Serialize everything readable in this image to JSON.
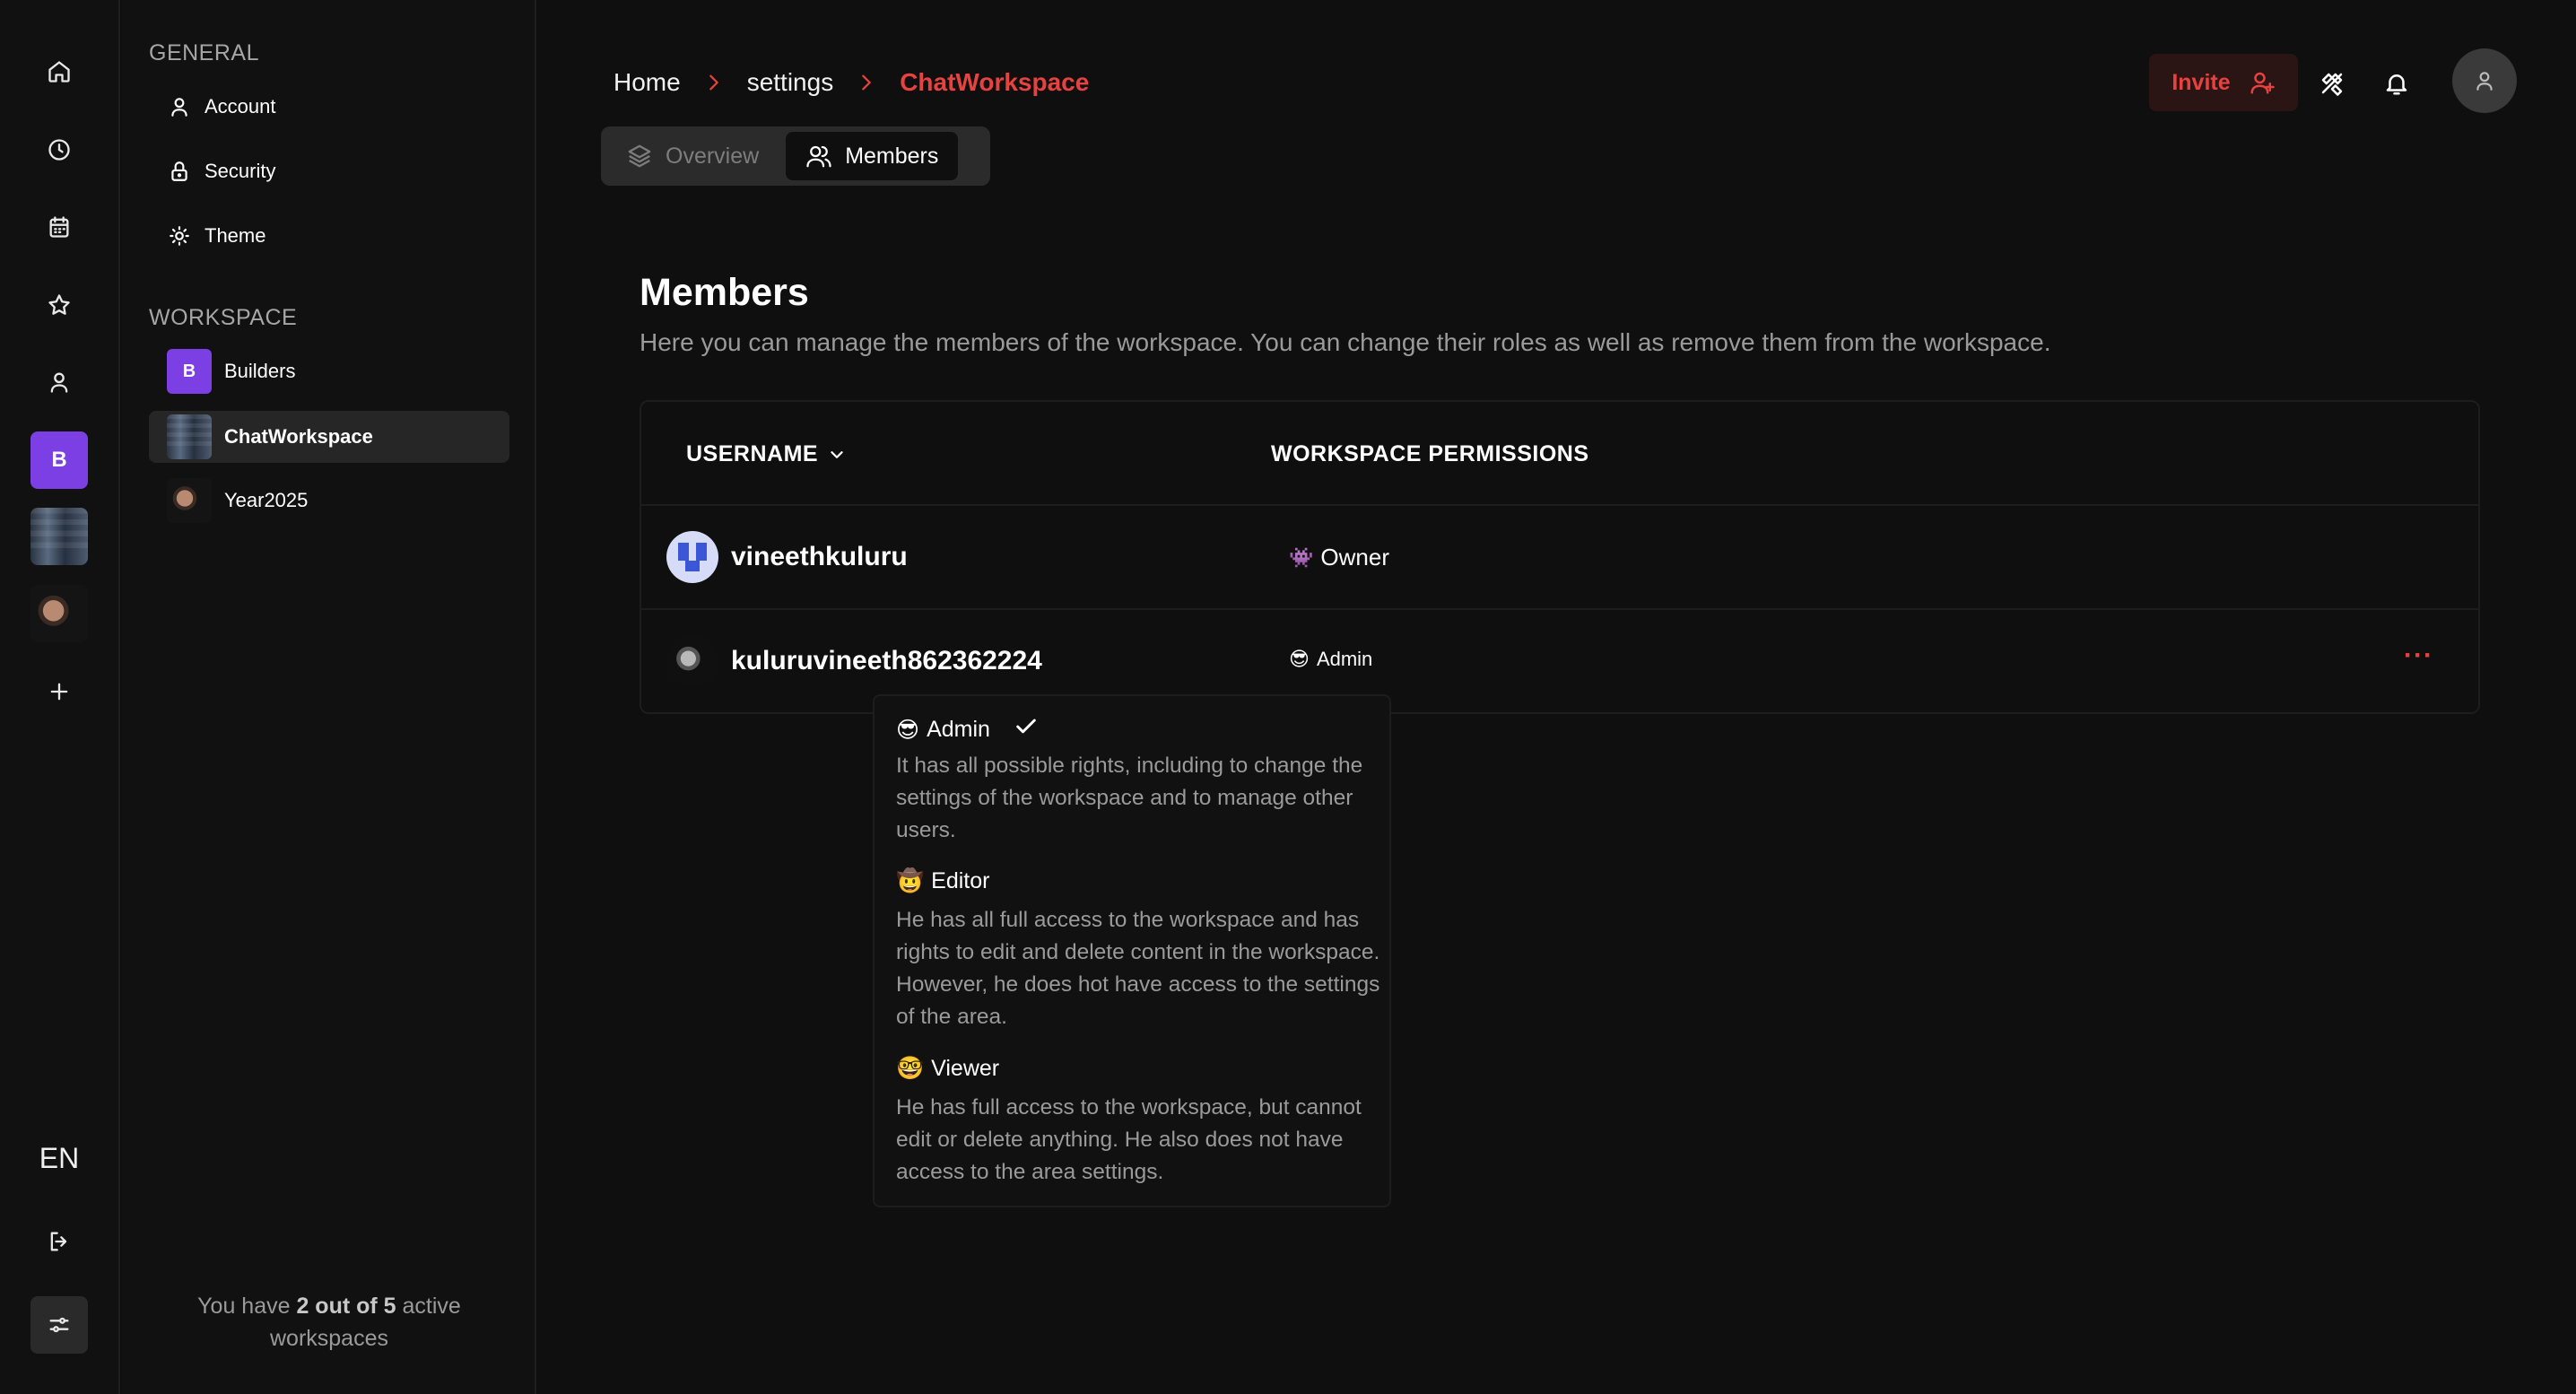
{
  "rail": {
    "language": "EN",
    "workspace_initial": "B",
    "icons": [
      "home-icon",
      "clock-icon",
      "calendar-icon",
      "star-icon",
      "user-icon",
      "plus-icon",
      "logout-icon",
      "sliders-icon"
    ]
  },
  "sidebar": {
    "general_title": "GENERAL",
    "general_items": [
      {
        "label": "Account",
        "icon": "user-icon"
      },
      {
        "label": "Security",
        "icon": "lock-icon"
      },
      {
        "label": "Theme",
        "icon": "sun-icon"
      }
    ],
    "workspace_title": "WORKSPACE",
    "workspaces": [
      {
        "label": "Builders",
        "initial": "B"
      },
      {
        "label": "ChatWorkspace"
      },
      {
        "label": "Year2025"
      }
    ],
    "footer": {
      "prefix": "You have ",
      "count": "2 out of 5",
      "suffix_1": " active",
      "suffix_2": "workspaces"
    }
  },
  "header": {
    "breadcrumb": [
      "Home",
      "settings",
      "ChatWorkspace"
    ],
    "tabs": [
      {
        "label": "Overview"
      },
      {
        "label": "Members"
      }
    ],
    "invite_label": "Invite"
  },
  "main": {
    "title": "Members",
    "description": "Here you can manage the members of the workspace. You can change their roles as well as remove them from the workspace.",
    "columns": {
      "username": "USERNAME",
      "permissions": "WORKSPACE PERMISSIONS"
    },
    "members": [
      {
        "username": "vineethkuluru",
        "role_emoji": "👾",
        "role": "Owner"
      },
      {
        "username": "kuluruvineeth862362224",
        "role_emoji": "😎",
        "role": "Admin",
        "actions": "···"
      }
    ]
  },
  "role_menu": {
    "roles": [
      {
        "emoji": "😎",
        "name": "Admin",
        "selected": true,
        "description": "It has all possible rights, including to change the settings of the workspace and to manage other users."
      },
      {
        "emoji": "🤠",
        "name": "Editor",
        "description": "He has all full access to the workspace and has rights to edit and delete content in the workspace. However, he does hot have access to the settings of the area."
      },
      {
        "emoji": "🤓",
        "name": "Viewer",
        "description": "He has full access to the workspace, but cannot edit or delete anything. He also does not have access to the area settings."
      }
    ]
  },
  "colors": {
    "accent": "#e8423f",
    "workspace_purple": "#7b3fe4",
    "background": "#0f0f0f"
  }
}
